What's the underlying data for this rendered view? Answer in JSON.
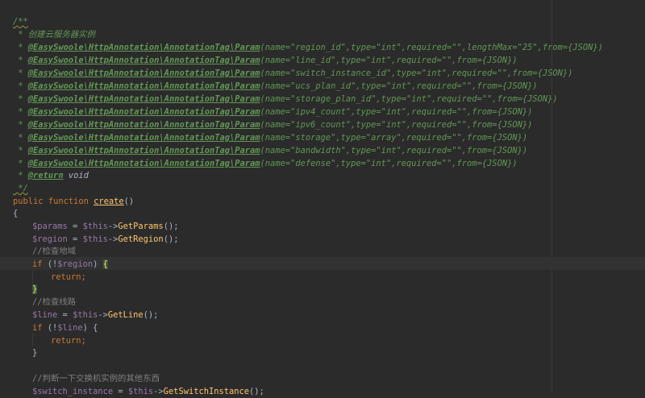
{
  "colors": {
    "background": "#2b2b2b",
    "doc_comment": "#629755",
    "keyword": "#cc7832",
    "function": "#ffc66d",
    "variable": "#9876aa",
    "comment": "#808080",
    "text": "#a9b7c6"
  },
  "code": {
    "doc_open": "/**",
    "doc_desc": " * 创建云服务器实例",
    "annotation_prefix": " * ",
    "annotation_tag": "@EasySwoole\\HttpAnnotation\\AnnotationTag\\Param",
    "params": [
      "(name=\"region_id\",type=\"int\",required=\"\",lengthMax=\"25\",from={JSON})",
      "(name=\"line_id\",type=\"int\",required=\"\",from={JSON})",
      "(name=\"switch_instance_id\",type=\"int\",required=\"\",from={JSON})",
      "(name=\"ucs_plan_id\",type=\"int\",required=\"\",from={JSON})",
      "(name=\"storage_plan_id\",type=\"int\",required=\"\",from={JSON})",
      "(name=\"ipv4_count\",type=\"int\",required=\"\",from={JSON})",
      "(name=\"ipv6_count\",type=\"int\",required=\"\",from={JSON})",
      "(name=\"storage\",type=\"array\",required=\"\",from={JSON})",
      "(name=\"bandwidth\",type=\"int\",required=\"\",from={JSON})",
      "(name=\"defense\",type=\"int\",required=\"\",from={JSON})"
    ],
    "return_tag": "@return",
    "return_type": " void",
    "doc_close": " */",
    "kw_public": "public",
    "kw_function": "function",
    "fn_name": "create",
    "parens": "()",
    "brace_open": "{",
    "brace_close": "}",
    "var_params": "$params",
    "var_region": "$region",
    "var_this": "$this",
    "var_line": "$line",
    "var_switch_instance": "$switch_instance",
    "assign": " = ",
    "arrow": "->",
    "call_end": "();",
    "get_params": "GetParams",
    "get_region": "GetRegion",
    "get_line": "GetLine",
    "get_switch_instance": "GetSwitchInstance",
    "comment_check_region": "//检查地域",
    "comment_check_line": "//检查线路",
    "comment_check_switch": "//判断一下交换机实例的其他东西",
    "kw_if": "if",
    "not_open": " (!",
    "close_paren": ")",
    "kw_return": "return",
    "semicolon": ";"
  }
}
